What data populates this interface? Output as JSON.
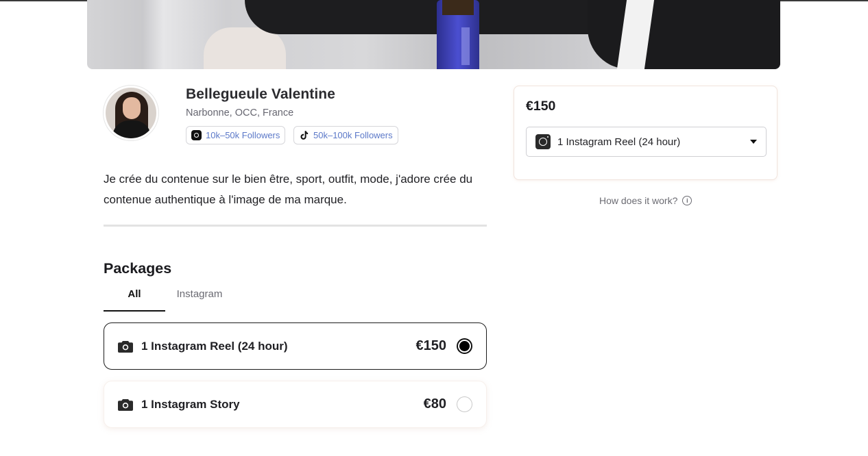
{
  "profile": {
    "name": "Bellegueule Valentine",
    "location": "Narbonne, OCC, France",
    "badges": [
      {
        "platform": "instagram",
        "icon": "instagram-icon",
        "label": "10k–50k Followers"
      },
      {
        "platform": "tiktok",
        "icon": "tiktok-icon",
        "label": "50k–100k Followers"
      }
    ],
    "bio": "Je crée du contenue sur le bien être, sport, outfit, mode, j'adore crée du contenue authentique à l'image de ma marque."
  },
  "packages": {
    "title": "Packages",
    "tabs": [
      {
        "label": "All",
        "active": true
      },
      {
        "label": "Instagram",
        "active": false
      }
    ],
    "items": [
      {
        "label": "1 Instagram Reel (24 hour)",
        "price": "€150",
        "selected": true,
        "icon": "camera-icon"
      },
      {
        "label": "1 Instagram Story",
        "price": "€80",
        "selected": false,
        "icon": "camera-icon"
      }
    ]
  },
  "checkout": {
    "price": "€150",
    "selected_package": "1 Instagram Reel (24 hour)",
    "selected_icon": "instagram-icon",
    "how_it_works": "How does it work?"
  },
  "colors": {
    "badge_text": "#5b78c8",
    "selected_border": "#1b1b1b",
    "card_border": "#f1e4dd"
  }
}
